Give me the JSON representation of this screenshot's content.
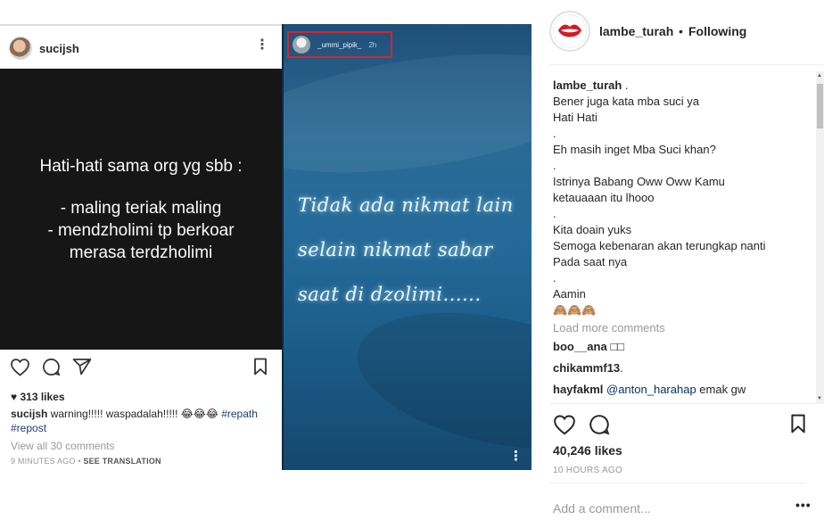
{
  "post_image": {
    "left_post": {
      "username": "sucijsh",
      "quote_heading": "Hati-hati sama org yg sbb :",
      "quote_lines": [
        "- maling teriak maling",
        "- mendzholimi tp berkoar",
        "merasa terdzholimi"
      ],
      "likes": "313 likes",
      "caption_user": "sucijsh",
      "caption_text": "warning!!!!! waspadalah!!!!! 😂😂😂",
      "caption_tags": [
        "#repath",
        "#repost"
      ],
      "view_comments": "View all 30 comments",
      "time_ago": "9 MINUTES AGO",
      "see_translation": "SEE TRANSLATION"
    },
    "right_story": {
      "username": "_ummi_pipik_",
      "age": "2h",
      "lines": [
        "Tidak ada nikmat lain",
        "selain nikmat sabar",
        "saat di dzolimi......"
      ]
    }
  },
  "panel": {
    "header": {
      "username": "lambe_turah",
      "separator": "•",
      "follow_label": "Following"
    },
    "caption": {
      "owner": "lambe_turah",
      "owner_suffix": " .",
      "lines": [
        "Bener juga kata mba suci ya",
        "Hati Hati",
        ".",
        "Eh masih inget Mba Suci khan?",
        ".",
        "Istrinya Babang Oww Oww Kamu",
        "ketauaaan itu lhooo",
        ".",
        "Kita doain yuks",
        "Semoga kebenaran akan terungkap nanti",
        "Pada saat nya",
        ".",
        "Aamin",
        "🙈🙈🙈"
      ]
    },
    "load_more": "Load more comments",
    "comments": [
      {
        "user": "boo__ana",
        "text": "□□",
        "mention": ""
      },
      {
        "user": "chikammf13",
        "text": ".",
        "mention": ""
      },
      {
        "user": "hayfakml",
        "text": " emak gw",
        "mention": "@anton_harahap"
      }
    ],
    "likes": "40,246 likes",
    "time_ago": "10 HOURS AGO",
    "comment_placeholder": "Add a comment...",
    "more_label": "•••"
  }
}
